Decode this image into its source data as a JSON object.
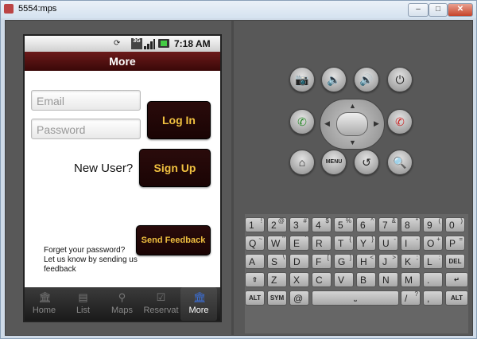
{
  "window": {
    "title": "5554:mps"
  },
  "status": {
    "time": "7:18 AM",
    "network": "3G"
  },
  "app": {
    "title": "More"
  },
  "login": {
    "email_placeholder": "Email",
    "password_placeholder": "Password",
    "login_label": "Log In",
    "new_user_text": "New User?",
    "signup_label": "Sign Up"
  },
  "feedback": {
    "text": "Forget your password? Let us know by sending us feedback",
    "button_label": "Send Feedback"
  },
  "tabs": [
    "Home",
    "List",
    "Maps",
    "Reservat",
    "More"
  ],
  "keyboard": {
    "row1": [
      {
        "m": "1",
        "s": "!"
      },
      {
        "m": "2",
        "s": "@"
      },
      {
        "m": "3",
        "s": "#"
      },
      {
        "m": "4",
        "s": "$"
      },
      {
        "m": "5",
        "s": "%"
      },
      {
        "m": "6",
        "s": "^"
      },
      {
        "m": "7",
        "s": "&"
      },
      {
        "m": "8",
        "s": "*"
      },
      {
        "m": "9",
        "s": "("
      },
      {
        "m": "0",
        "s": ")"
      }
    ],
    "row2": [
      {
        "m": "Q",
        "s": "~"
      },
      {
        "m": "W",
        "s": "\""
      },
      {
        "m": "E",
        "s": "´"
      },
      {
        "m": "R",
        "s": ""
      },
      {
        "m": "T",
        "s": "{"
      },
      {
        "m": "Y",
        "s": "}"
      },
      {
        "m": "U",
        "s": "-"
      },
      {
        "m": "I",
        "s": "-"
      },
      {
        "m": "O",
        "s": "+"
      },
      {
        "m": "P",
        "s": "="
      }
    ],
    "row3": [
      {
        "m": "A",
        "s": ""
      },
      {
        "m": "S",
        "s": "\\"
      },
      {
        "m": "D",
        "s": ""
      },
      {
        "m": "F",
        "s": "["
      },
      {
        "m": "G",
        "s": "]"
      },
      {
        "m": "H",
        "s": "<"
      },
      {
        "m": "J",
        "s": ">"
      },
      {
        "m": "K",
        "s": ";"
      },
      {
        "m": "L",
        "s": ":"
      }
    ],
    "row4": [
      {
        "m": "Z",
        "s": ""
      },
      {
        "m": "X",
        "s": ""
      },
      {
        "m": "C",
        "s": ""
      },
      {
        "m": "V",
        "s": ""
      },
      {
        "m": "B",
        "s": ""
      },
      {
        "m": "N",
        "s": ""
      },
      {
        "m": "M",
        "s": ""
      },
      {
        "m": ".",
        "s": ""
      }
    ],
    "del_label": "DEL",
    "alt_label": "ALT",
    "sym_label": "SYM",
    "at_label": "@",
    "slash_label": "/",
    "question_label": "?",
    "comma_label": ","
  }
}
